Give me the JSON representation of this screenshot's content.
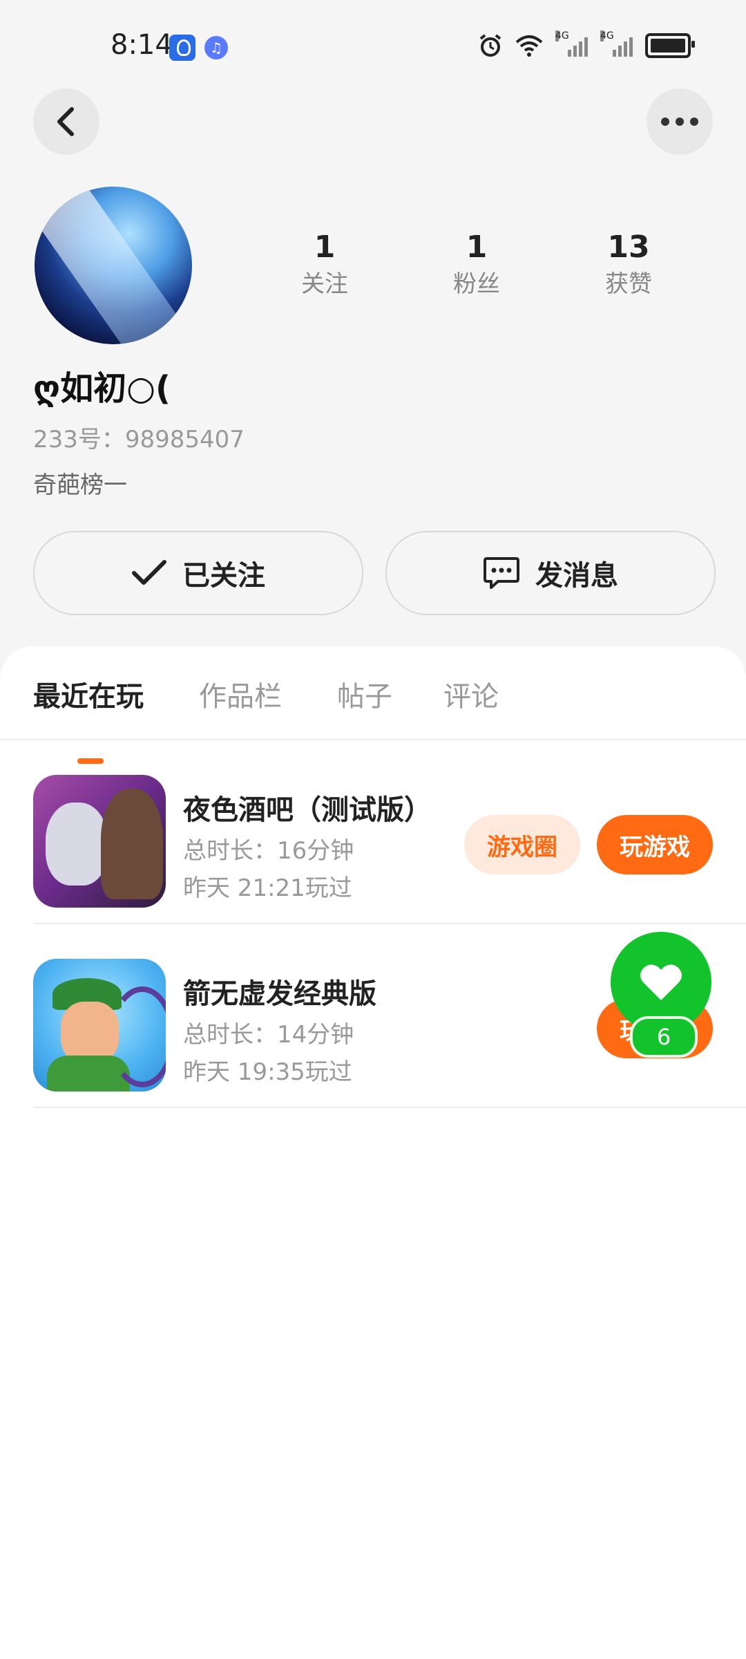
{
  "status_bar": {
    "time": "8:14",
    "network_label": "4G",
    "network_label_2": "4G"
  },
  "profile": {
    "stats": [
      {
        "value": "1",
        "label": "关注"
      },
      {
        "value": "1",
        "label": "粉丝"
      },
      {
        "value": "13",
        "label": "获赞"
      }
    ],
    "username": "ღ如初○(",
    "uid": "233号：98985407",
    "bio": "奇葩榜一",
    "follow_button": "已关注",
    "message_button": "发消息"
  },
  "tabs": [
    {
      "label": "最近在玩",
      "active": true
    },
    {
      "label": "作品栏",
      "active": false
    },
    {
      "label": "帖子",
      "active": false
    },
    {
      "label": "评论",
      "active": false
    }
  ],
  "games": [
    {
      "title": "夜色酒吧（测试版）",
      "duration": "总时长：16分钟",
      "last_played": "昨天 21:21玩过",
      "circle_button": "游戏圈",
      "play_button": "玩游戏"
    },
    {
      "title": "箭无虚发经典版",
      "duration": "总时长：14分钟",
      "last_played": "昨天 19:35玩过",
      "play_button": "玩游戏"
    }
  ],
  "fab": {
    "count": "6"
  },
  "colors": {
    "accent": "#ff6a13",
    "accent_light": "#ffe9dc",
    "fab_green": "#12c32c"
  }
}
